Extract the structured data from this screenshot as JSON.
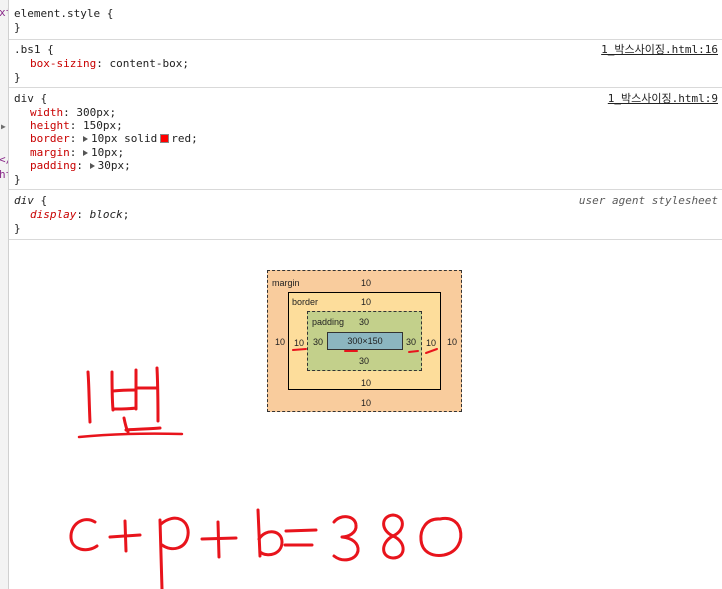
{
  "styles": {
    "rules": [
      {
        "selector": "element.style",
        "open": "{",
        "close": "}",
        "declarations": [],
        "source": ""
      },
      {
        "selector": ".bs1",
        "open": "{",
        "close": "}",
        "declarations": [
          {
            "property": "box-sizing",
            "value": "content-box"
          }
        ],
        "source": "1_박스사이징.html:16"
      },
      {
        "selector": "div",
        "open": "{",
        "close": "}",
        "declarations": [
          {
            "property": "width",
            "value": "300px"
          },
          {
            "property": "height",
            "value": "150px"
          },
          {
            "property": "border",
            "value_before": "10px solid",
            "value_after": "red"
          },
          {
            "property": "margin",
            "value": "10px"
          },
          {
            "property": "padding",
            "value": "30px"
          }
        ],
        "source": "1_박스사이징.html:9"
      },
      {
        "selector": "div",
        "open": "{",
        "close": "}",
        "declarations": [
          {
            "property": "display",
            "value": "block"
          }
        ],
        "source": "user agent stylesheet"
      }
    ]
  },
  "box_model": {
    "margin": {
      "label": "margin",
      "top": "10",
      "right": "10",
      "bottom": "10",
      "left": "10"
    },
    "border": {
      "label": "border",
      "top": "10",
      "right": "10",
      "bottom": "10",
      "left": "10"
    },
    "padding": {
      "label": "padding",
      "top": "30",
      "right": "30",
      "bottom": "30",
      "left": "30"
    },
    "content": {
      "size": "300×150"
    }
  },
  "annotations": {
    "label": "1번",
    "equation": "c+p+b=380",
    "ink_color": "#e8141c"
  },
  "colors": {
    "margin_fill": "#f9cc9d",
    "border_fill": "#fddd9b",
    "padding_fill": "#c3d08b",
    "content_fill": "#8cb6c0",
    "property_name": "#c80000",
    "swatch": "#ff0000"
  },
  "gutter_fragments": [
    "xt",
    "</",
    "ht"
  ]
}
